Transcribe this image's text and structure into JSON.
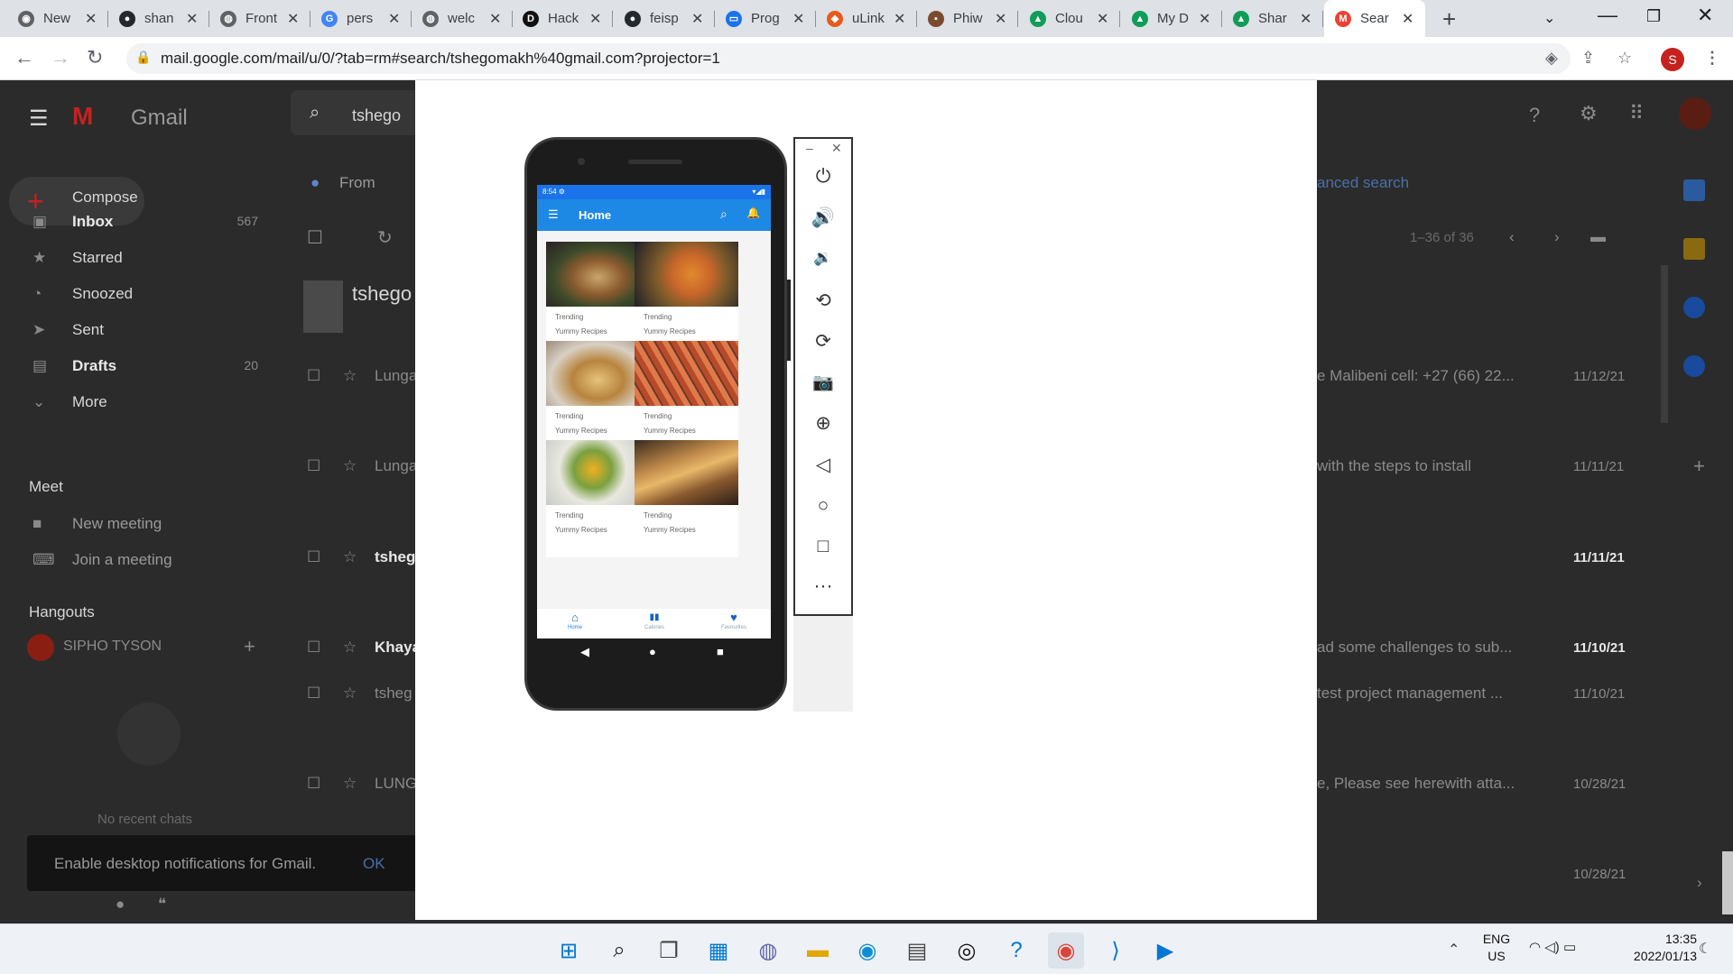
{
  "browser": {
    "tabs": [
      {
        "label": "New",
        "icon": "chrome-icon",
        "color": "#5f6368"
      },
      {
        "label": "shan",
        "icon": "github-icon",
        "color": "#24292f"
      },
      {
        "label": "Front",
        "icon": "globe-icon",
        "color": "#5f6368"
      },
      {
        "label": "pers",
        "icon": "google-icon",
        "color": "#4285f4"
      },
      {
        "label": "welc",
        "icon": "globe-icon",
        "color": "#5f6368"
      },
      {
        "label": "Hack",
        "icon": "dev-icon",
        "color": "#111111"
      },
      {
        "label": "feisp",
        "icon": "github-icon",
        "color": "#24292f"
      },
      {
        "label": "Prog",
        "icon": "doc-icon",
        "color": "#1a73e8"
      },
      {
        "label": "uLink",
        "icon": "ulink-icon",
        "color": "#e8591a"
      },
      {
        "label": "Phiw",
        "icon": "photo-icon",
        "color": "#7b4a2e"
      },
      {
        "label": "Clou",
        "icon": "drive-icon",
        "color": "#0f9d58"
      },
      {
        "label": "My D",
        "icon": "drive-icon",
        "color": "#0f9d58"
      },
      {
        "label": "Shar",
        "icon": "drive-icon",
        "color": "#0f9d58"
      },
      {
        "label": "Sear",
        "icon": "gmail-icon",
        "color": "#ea4335",
        "active": true
      }
    ],
    "url": "mail.google.com/mail/u/0/?tab=rm#search/tshegomakh%40gmail.com?projector=1",
    "profile_initial": "S"
  },
  "gmail": {
    "logo": "Gmail",
    "search_value": "tshego",
    "compose": "Compose",
    "nav": [
      {
        "label": "Inbox",
        "count": "567",
        "bold": true
      },
      {
        "label": "Starred",
        "count": ""
      },
      {
        "label": "Snoozed",
        "count": ""
      },
      {
        "label": "Sent",
        "count": ""
      },
      {
        "label": "Drafts",
        "count": "20",
        "bold": true
      },
      {
        "label": "More",
        "count": ""
      }
    ],
    "meet_header": "Meet",
    "meet_items": [
      "New meeting",
      "Join a meeting"
    ],
    "hangouts_header": "Hangouts",
    "hangouts_user": "SIPHO TYSON",
    "no_chats": "No recent chats",
    "filter_from": "From",
    "advanced_search": "anced search",
    "pager": "1–36 of 36",
    "thread_header": "tshego",
    "rows": [
      {
        "sender": "Lunga",
        "snippet": "e Malibeni cell: +27 (66) 22...",
        "date": "11/12/21",
        "bold": false
      },
      {
        "sender": "Lunga",
        "snippet": "with the steps to install",
        "date": "11/11/21",
        "bold": false
      },
      {
        "sender": "tsheg",
        "snippet": "",
        "date": "11/11/21",
        "bold": true
      },
      {
        "sender": "Khaya",
        "snippet": "ad some challenges to sub...",
        "date": "11/10/21",
        "bold": true
      },
      {
        "sender": "tsheg",
        "snippet": "test project management ...",
        "date": "11/10/21",
        "bold": false
      },
      {
        "sender": "LUNG",
        "snippet": "e, Please see herewith atta...",
        "date": "10/28/21",
        "bold": false
      },
      {
        "sender": "",
        "snippet": "",
        "date": "10/28/21",
        "bold": false
      }
    ],
    "notification": "Enable desktop notifications for Gmail.",
    "notification_ok": "OK"
  },
  "phone": {
    "status_time": "8:54",
    "app_title": "Home",
    "cards": [
      {
        "line1": "Trending",
        "line2": "Yummy Recipes",
        "img": "burger"
      },
      {
        "line1": "Trending",
        "line2": "Yummy Recipes",
        "img": "squash"
      },
      {
        "line1": "Trending",
        "line2": "Yummy Recipes",
        "img": "tacos"
      },
      {
        "line1": "Trending",
        "line2": "Yummy Recipes",
        "img": "carrots"
      },
      {
        "line1": "Trending",
        "line2": "Yummy Recipes",
        "img": "salad"
      },
      {
        "line1": "Trending",
        "line2": "Yummy Recipes",
        "img": "sandwich"
      }
    ],
    "bottom_nav": [
      "Home",
      "Calories",
      "Favourites"
    ]
  },
  "emulator_toolbar": [
    "power-icon",
    "volume-up-icon",
    "volume-down-icon",
    "rotate-left-icon",
    "rotate-right-icon",
    "camera-icon",
    "zoom-icon",
    "back-icon",
    "home-icon",
    "overview-icon",
    "more-icon"
  ],
  "taskbar": {
    "lang_top": "ENG",
    "lang_bottom": "US",
    "time": "13:35",
    "date": "2022/01/13"
  }
}
